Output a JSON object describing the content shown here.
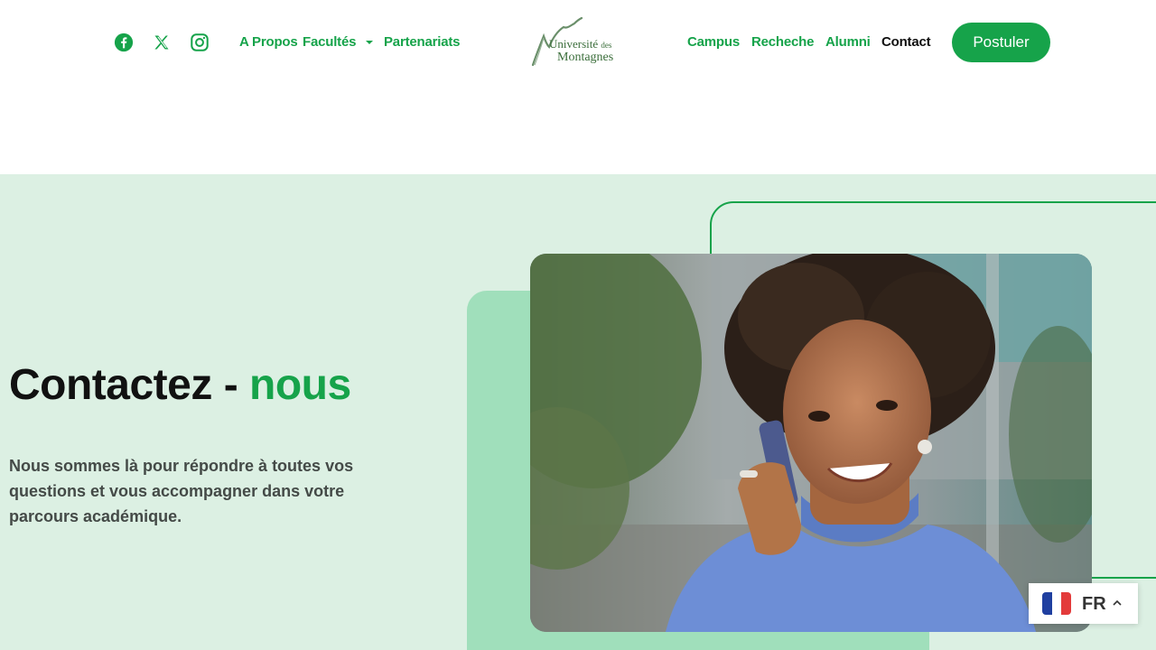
{
  "header": {
    "social": [
      {
        "name": "facebook-icon"
      },
      {
        "name": "x-icon"
      },
      {
        "name": "instagram-icon"
      }
    ],
    "nav_left": [
      "A Propos",
      "Facultés",
      "Partenariats"
    ],
    "nav_right": [
      "Campus",
      "Recheche",
      "Alumni",
      "Contact"
    ],
    "active_item": "Contact",
    "logo": {
      "line1": "Université",
      "line1_small": "des",
      "line2": "Montagnes"
    },
    "cta_label": "Postuler"
  },
  "hero": {
    "title_part1": "Contactez - ",
    "title_accent": "nous",
    "subtitle": "Nous sommes là pour répondre à toutes vos questions et vous accompagner dans votre parcours académique."
  },
  "language": {
    "code": "FR",
    "flag_icon": "france-flag-icon"
  },
  "colors": {
    "accent": "#16a34a",
    "hero_bg": "#dcf0e3",
    "green_block": "#a0dfbb",
    "text_dark": "#111111"
  }
}
